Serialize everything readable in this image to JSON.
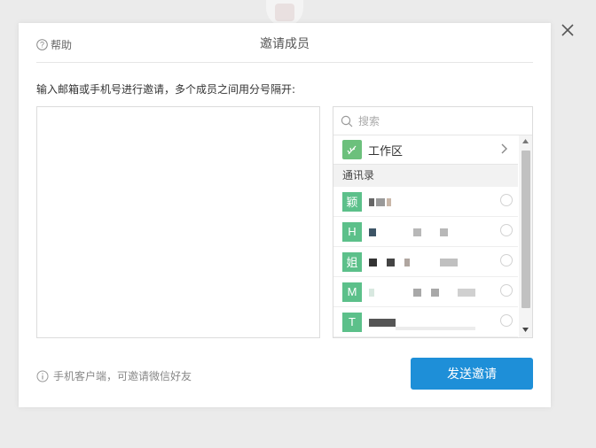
{
  "dialog": {
    "help_label": "帮助",
    "title": "邀请成员",
    "instruction": "输入邮箱或手机号进行邀请，多个成员之间用分号隔开:",
    "email_input_value": ""
  },
  "picker": {
    "search_placeholder": "搜索",
    "workspace_label": "工作区",
    "contacts_header": "通讯录",
    "members": [
      {
        "avatar": "颖"
      },
      {
        "avatar": "H"
      },
      {
        "avatar": "姐"
      },
      {
        "avatar": "M"
      },
      {
        "avatar": "T"
      }
    ]
  },
  "footer": {
    "hint": "手机客户端，可邀请微信好友",
    "send_label": "发送邀请"
  },
  "colors": {
    "accent": "#1e8fd8",
    "avatar_green": "#5cc08a",
    "scroll_thumb": "#c1c1c1"
  },
  "icons": [
    "help-icon",
    "close-icon",
    "search-icon",
    "workspace-icon",
    "chevron-right-icon",
    "info-icon",
    "radio-icon"
  ]
}
